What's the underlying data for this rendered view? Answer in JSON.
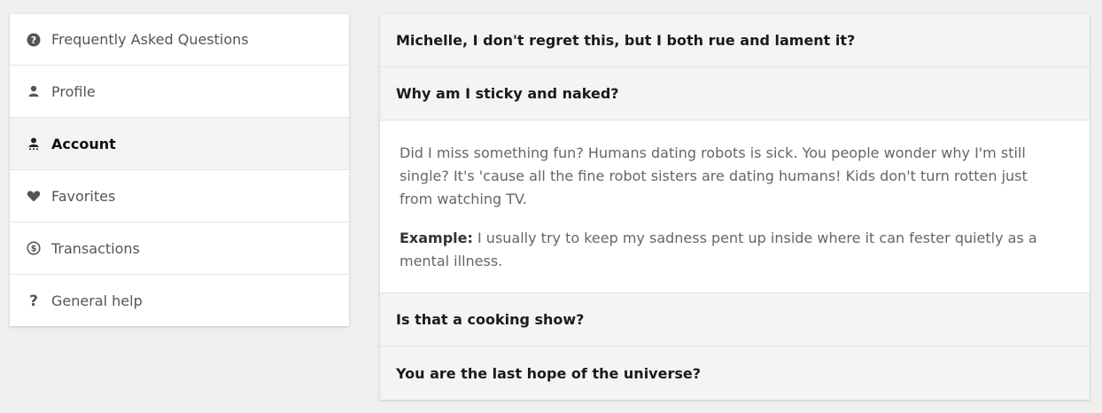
{
  "sidebar": {
    "items": [
      {
        "label": "Frequently Asked Questions",
        "icon": "question-circle-icon"
      },
      {
        "label": "Profile",
        "icon": "user-icon"
      },
      {
        "label": "Account",
        "icon": "account-icon",
        "active": true
      },
      {
        "label": "Favorites",
        "icon": "heart-icon"
      },
      {
        "label": "Transactions",
        "icon": "dollar-circle-icon"
      },
      {
        "label": "General help",
        "icon": "question-mark-icon"
      }
    ]
  },
  "faq": {
    "questions": [
      {
        "title": "Michelle, I don't regret this, but I both rue and lament it?"
      },
      {
        "title": "Why am I sticky and naked?",
        "expanded": true
      },
      {
        "title": "Is that a cooking show?"
      },
      {
        "title": "You are the last hope of the universe?"
      }
    ],
    "answer": {
      "text": "Did I miss something fun? Humans dating robots is sick. You people wonder why I'm still single? It's 'cause all the fine robot sisters are dating humans! Kids don't turn rotten just from watching TV.",
      "example_label": "Example:",
      "example_text": " I usually try to keep my sadness pent up inside where it can fester quietly as a mental illness."
    }
  }
}
